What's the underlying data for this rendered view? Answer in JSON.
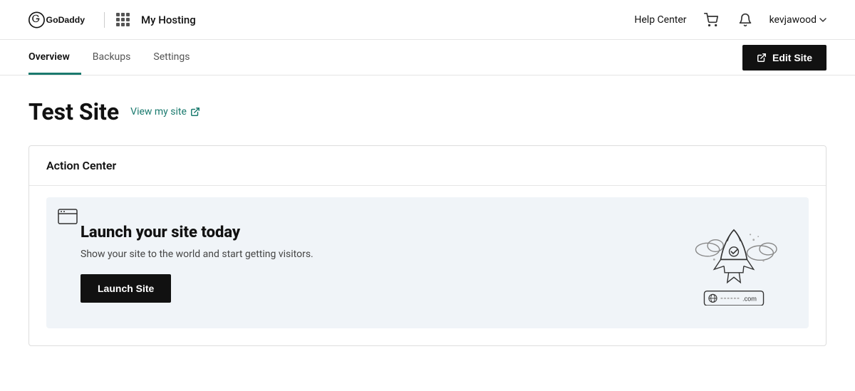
{
  "header": {
    "brand": "GoDaddy",
    "nav_label": "My Hosting",
    "help_center": "Help Center",
    "username": "kevjawood",
    "chevron": "▾"
  },
  "tabs": {
    "items": [
      {
        "label": "Overview",
        "active": true
      },
      {
        "label": "Backups",
        "active": false
      },
      {
        "label": "Settings",
        "active": false
      }
    ],
    "edit_site_label": "Edit Site"
  },
  "page": {
    "site_title": "Test Site",
    "view_site_link": "View my site",
    "action_center_title": "Action Center",
    "launch_title": "Launch your site today",
    "launch_subtitle": "Show your site to the world and start getting visitors.",
    "launch_btn_label": "Launch Site"
  }
}
